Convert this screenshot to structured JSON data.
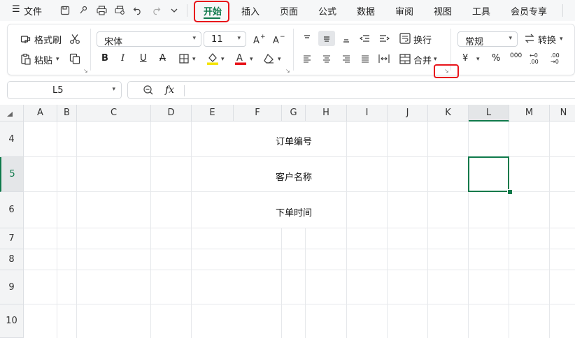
{
  "menubar": {
    "menu_icon": "☰",
    "file_label": "文件",
    "tabs": [
      {
        "label": "开始",
        "active": true
      },
      {
        "label": "插入"
      },
      {
        "label": "页面"
      },
      {
        "label": "公式"
      },
      {
        "label": "数据"
      },
      {
        "label": "审阅"
      },
      {
        "label": "视图"
      },
      {
        "label": "工具"
      },
      {
        "label": "会员专享"
      }
    ]
  },
  "ribbon": {
    "format_painter": "格式刷",
    "paste": "粘贴",
    "font_name": "宋体",
    "font_size": "11",
    "bold": "B",
    "italic": "I",
    "underline": "U",
    "strikethrough": "A",
    "font_color_letter": "A",
    "wrap_text": "换行",
    "merge": "合并",
    "number_format": "常规",
    "convert": "转换",
    "currency": "¥",
    "percent": "%",
    "thousands": "000",
    "dec_increase": "←0 .00",
    "dec_decrease": ".00 →0",
    "colors": {
      "fill_highlight": "#f5e400",
      "font_color": "#e8141b",
      "accent": "#0f7a4b",
      "highlight_box": "#e8141b"
    }
  },
  "formula_bar": {
    "name_box_value": "L5",
    "zoom_icon": "search-icon",
    "fx_label": "fx",
    "formula_value": ""
  },
  "sheet": {
    "columns": [
      "A",
      "B",
      "C",
      "D",
      "E",
      "F",
      "G",
      "H",
      "I",
      "J",
      "K",
      "L",
      "M",
      "N"
    ],
    "selected_column": "L",
    "rows": [
      "4",
      "5",
      "6",
      "7",
      "8",
      "9",
      "10"
    ],
    "selected_row": "5",
    "selected_cell": "L5",
    "cells": [
      {
        "ref": "F4",
        "value": "订单编号"
      },
      {
        "ref": "F5",
        "value": "客户名称"
      },
      {
        "ref": "F6",
        "value": "下单时间"
      }
    ]
  }
}
